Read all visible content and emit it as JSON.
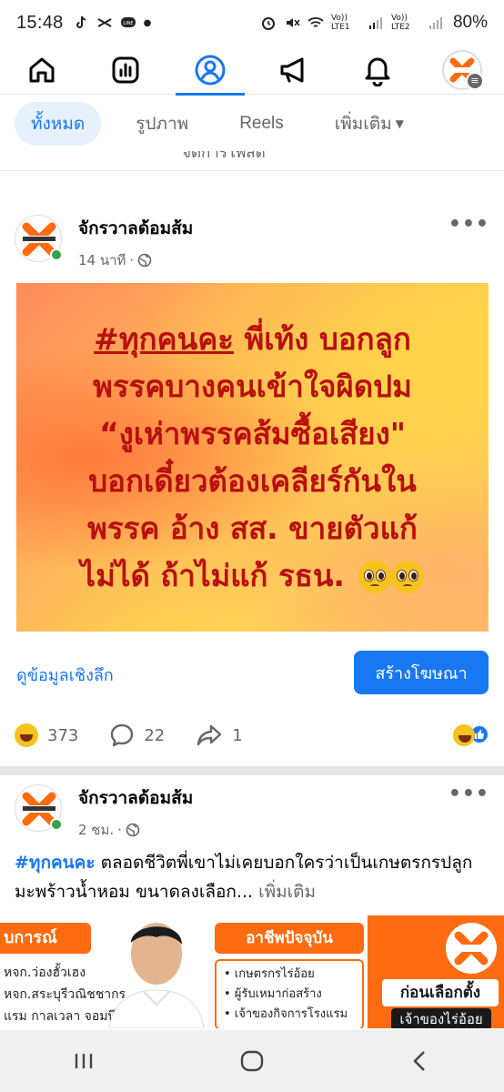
{
  "status_bar": {
    "time": "15:48",
    "battery": "80%",
    "sim1": "Vo)) LTE1",
    "sim2": "Vo)) LTE2"
  },
  "top_nav": {
    "items": [
      "home-icon",
      "dashboard-icon",
      "profile-icon",
      "megaphone-icon",
      "bell-icon",
      "page-avatar"
    ],
    "active": "profile-icon",
    "accent": "#1877f2"
  },
  "filters": {
    "all": "ทั้งหมด",
    "photos": "รูปภาพ",
    "reels": "Reels",
    "more": "เพิ่มเติม"
  },
  "partial_row_text": "จัดการโพสต์",
  "post1": {
    "page_name": "จักรวาลด้อมส้ม",
    "time": "14 นาที",
    "image_lines": [
      "#ทุกคนคะ พี่เท้ง บอกลูก",
      "พรรคบางคนเข้าใจผิดปม",
      "“งูเห่าพรรคส้มซื้อเสียง\"",
      "บอกเดี๋ยวต้องเคลียร์กันใน",
      "พรรค อ้าง สส. ขายตัวแก้",
      "ไม่ได้ ถ้าไม่แก้ รธน."
    ],
    "image_hashtag": "#ทุกคนคะ",
    "image_line1_rest": " พี่เท้ง บอกลูก",
    "insights": "ดูข้อมูลเชิงลึก",
    "boost": "สร้างโฆษณา",
    "reactions": "373",
    "comments": "22",
    "shares": "1"
  },
  "post2": {
    "page_name": "จักรวาลด้อมส้ม",
    "time": "2 ชม.",
    "hashtag": "#ทุกคนคะ",
    "text": " ตลอดชีวิตพี่เขาไม่เคยบอกใครว่าเป็นเกษตรกรปลูกมะพร้าวน้ำหอม ขนาดลงเลือก...",
    "see_more": " เพิ่มเติม"
  },
  "banner": {
    "left_header": "บการณ์",
    "left_lines": [
      "หจก.ว่องฮั้วเฮง",
      "หจก.สระบุรีวณิชชากร",
      "แรม กาลเวลา จอมบึง"
    ],
    "mid_header": "อาชีพปัจจุบัน",
    "mid_items": [
      "• เกษตรกรไร่อ้อย",
      "• ผู้รับเหมาก่อสร้าง",
      "• เจ้าของกิจการโรงแรม"
    ],
    "right_before": "ก่อนเลือกตั้ง",
    "right_owner": "เจ้าของไร่อ้อย"
  }
}
